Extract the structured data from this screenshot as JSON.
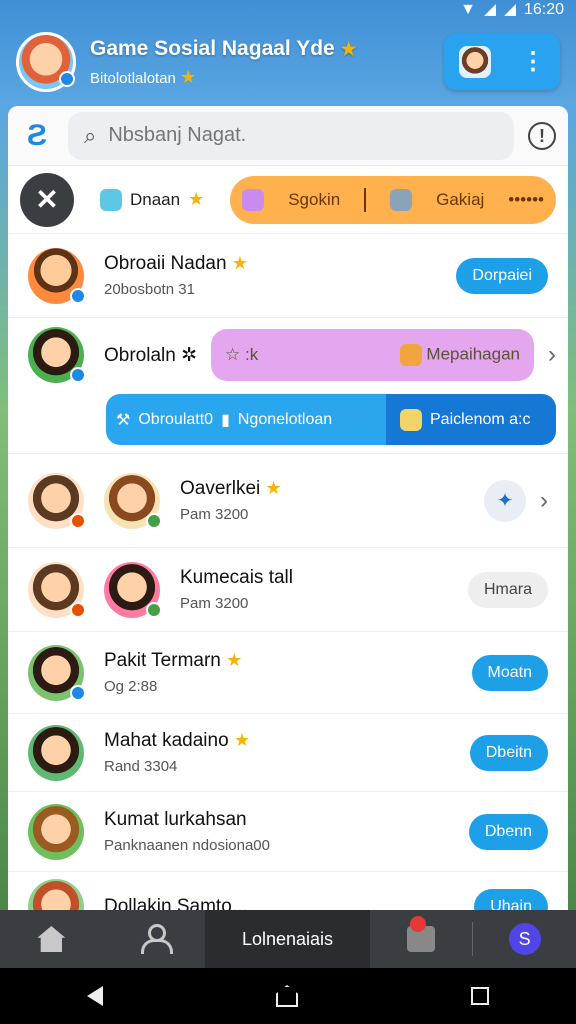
{
  "status_bar": {
    "time": "16:20"
  },
  "header": {
    "title": "Game Sosial Nagaal Yde",
    "subtitle": "Bitolotlalotan",
    "star": "★",
    "menu_glyph": "⋮"
  },
  "search": {
    "placeholder": "Nbsbanj Nagat."
  },
  "filters": {
    "close_glyph": "✕",
    "chip1_label": "Dnaan",
    "chip2_left": "Sgokin",
    "chip2_right": "Gakiaj",
    "chip2_dots": "••••••"
  },
  "rows": [
    {
      "name": "Obroaii Nadan",
      "sub": "20bosbotn 31",
      "action": "Dorpaiei"
    },
    {
      "name": "Obrolaln",
      "purple_left": ":k",
      "purple_right": "Mepaihagan",
      "blue_left": "Obroulatt0",
      "blue_mid": "Ngonelotloan",
      "blue_right": "Paiclenom a:c"
    },
    {
      "name": "Oaverlkei",
      "sub": "Pam 3200"
    },
    {
      "name": "Kumecais tall",
      "sub": "Pam 3200",
      "action": "Hmara"
    },
    {
      "name": "Pakit Termarn",
      "sub": "Og 2:88",
      "action": "Moatn"
    },
    {
      "name": "Mahat kadaino",
      "sub": "Rand 3304",
      "action": "Dbeitn"
    },
    {
      "name": "Kumat lurkahsan",
      "sub": "Panknaanen ndosiona00",
      "action": "Dbenn"
    },
    {
      "name": "Dollakin Samto...",
      "action": "Uhain"
    }
  ],
  "bottom_nav": {
    "active_label": "Lolnenaiais",
    "s_label": "S"
  },
  "icons": {
    "chevron": "›",
    "search": "⌕",
    "info": "!",
    "logo": "Ƨ"
  },
  "colors": {
    "accent": "#1ea0e8",
    "orange_chip": "#ffb14d",
    "purple_bar": "#e4a6ee",
    "nav_bg": "#3a3d42"
  }
}
